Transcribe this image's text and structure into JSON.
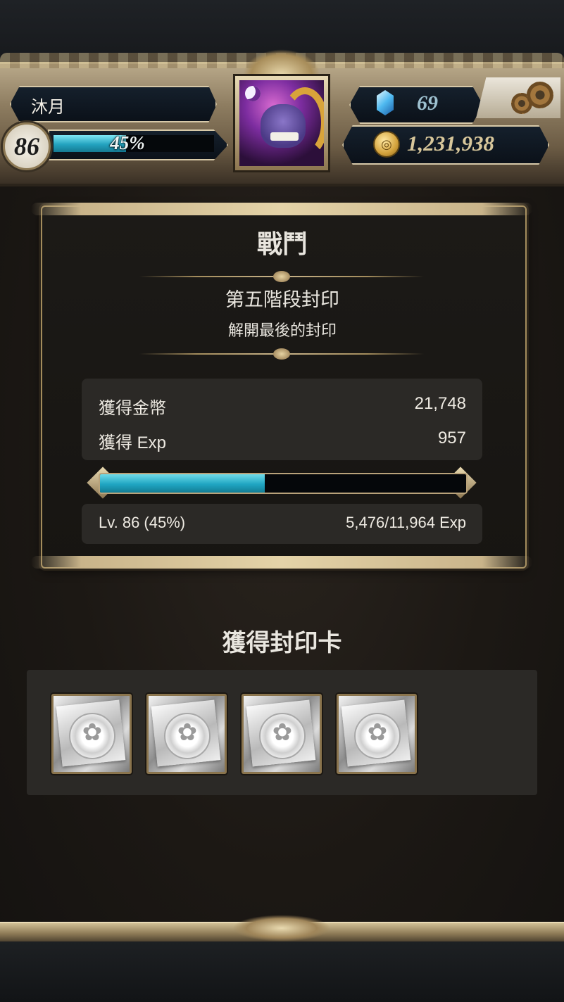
{
  "header": {
    "player_name": "沐月",
    "level": "86",
    "exp_percent_label": "45%",
    "exp_fraction": 0.45,
    "gems": "69",
    "coins": "1,231,938"
  },
  "battle": {
    "title": "戰鬥",
    "stage_title": "第五階段封印",
    "stage_subtitle": "解開最後的封印",
    "rewards": [
      {
        "label": "獲得金幣",
        "value": "21,748"
      },
      {
        "label": "獲得 Exp",
        "value": "957"
      }
    ],
    "exp_bar_fraction": 0.45,
    "level_label": "Lv. 86 (45%)",
    "exp_label": "5,476/11,964 Exp"
  },
  "cards": {
    "title": "獲得封印卡",
    "items": [
      {
        "name": "seal-card"
      },
      {
        "name": "seal-card"
      },
      {
        "name": "seal-card"
      },
      {
        "name": "seal-card"
      }
    ]
  },
  "colors": {
    "accent_gold": "#c9b48a",
    "exp_cyan": "#1fa5c2",
    "panel_bg": "#2b2926"
  },
  "icons": {
    "gem": "gem-icon",
    "coin": "coin-icon",
    "settings": "gear-icon"
  }
}
